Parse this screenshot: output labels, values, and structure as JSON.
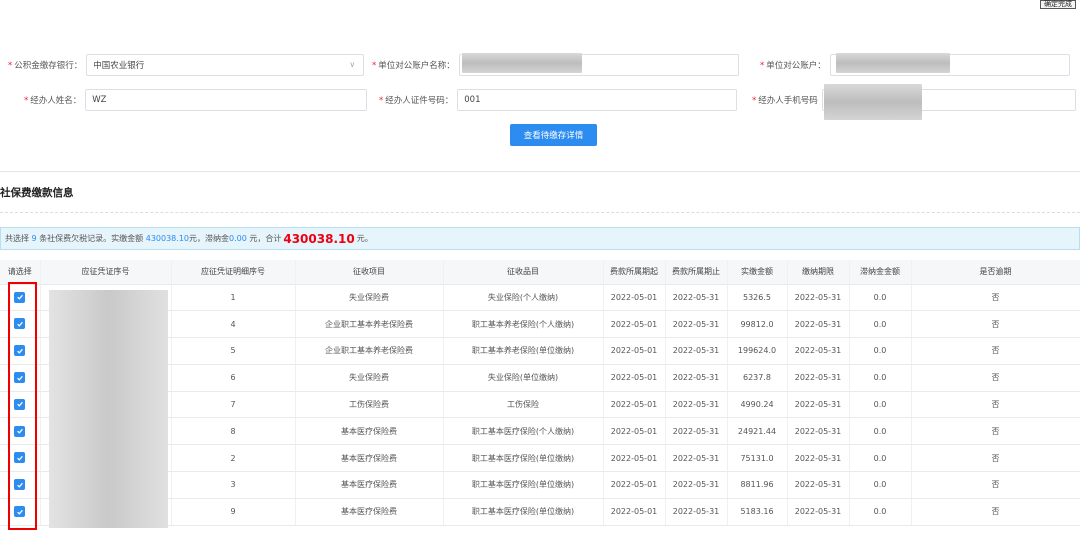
{
  "top_button": "确定完成",
  "form": {
    "bank_label": "公积金缴存银行：",
    "bank_value": "中国农业银行",
    "unit_account_name_label": "单位对公账户名称：",
    "unit_account_label": "单位对公账户：",
    "handler_name_label": "经办人姓名：",
    "handler_name_value": "WZ",
    "handler_id_label": "经办人证件号码：",
    "handler_id_value": "001",
    "handler_phone_label": "经办人手机号码",
    "query_button": "查看待缴存详情"
  },
  "section_title": "社保费缴款信息",
  "summary": {
    "prefix": "共选择",
    "count": "9",
    "mid": "条社保费欠税记录。实缴金额",
    "paid": "430038.10",
    "mid2": "元，滞纳金",
    "late": "0.00",
    "mid3": "元，合计",
    "total": "430038.10",
    "suffix": "元。"
  },
  "table": {
    "headers": [
      "请选择",
      "应征凭证序号",
      "应征凭证明细序号",
      "征收项目",
      "征收品目",
      "费款所属期起",
      "费款所属期止",
      "实缴金额",
      "缴纳期限",
      "滞纳金金额",
      "是否逾期"
    ],
    "rows": [
      [
        "1",
        "失业保险费",
        "失业保险(个人缴纳)",
        "2022-05-01",
        "2022-05-31",
        "5326.5",
        "2022-05-31",
        "0.0",
        "否"
      ],
      [
        "4",
        "企业职工基本养老保险费",
        "职工基本养老保险(个人缴纳)",
        "2022-05-01",
        "2022-05-31",
        "99812.0",
        "2022-05-31",
        "0.0",
        "否"
      ],
      [
        "5",
        "企业职工基本养老保险费",
        "职工基本养老保险(单位缴纳)",
        "2022-05-01",
        "2022-05-31",
        "199624.0",
        "2022-05-31",
        "0.0",
        "否"
      ],
      [
        "6",
        "失业保险费",
        "失业保险(单位缴纳)",
        "2022-05-01",
        "2022-05-31",
        "6237.8",
        "2022-05-31",
        "0.0",
        "否"
      ],
      [
        "7",
        "工伤保险费",
        "工伤保险",
        "2022-05-01",
        "2022-05-31",
        "4990.24",
        "2022-05-31",
        "0.0",
        "否"
      ],
      [
        "8",
        "基本医疗保险费",
        "职工基本医疗保险(个人缴纳)",
        "2022-05-01",
        "2022-05-31",
        "24921.44",
        "2022-05-31",
        "0.0",
        "否"
      ],
      [
        "2",
        "基本医疗保险费",
        "职工基本医疗保险(单位缴纳)",
        "2022-05-01",
        "2022-05-31",
        "75131.0",
        "2022-05-31",
        "0.0",
        "否"
      ],
      [
        "3",
        "基本医疗保险费",
        "职工基本医疗保险(单位缴纳)",
        "2022-05-01",
        "2022-05-31",
        "8811.96",
        "2022-05-31",
        "0.0",
        "否"
      ],
      [
        "9",
        "基本医疗保险费",
        "职工基本医疗保险(单位缴纳)",
        "2022-05-01",
        "2022-05-31",
        "5183.16",
        "2022-05-31",
        "0.0",
        "否"
      ]
    ]
  },
  "colors": {
    "primary": "#2d8cf0",
    "required": "#e23",
    "highlight": "#e00"
  }
}
